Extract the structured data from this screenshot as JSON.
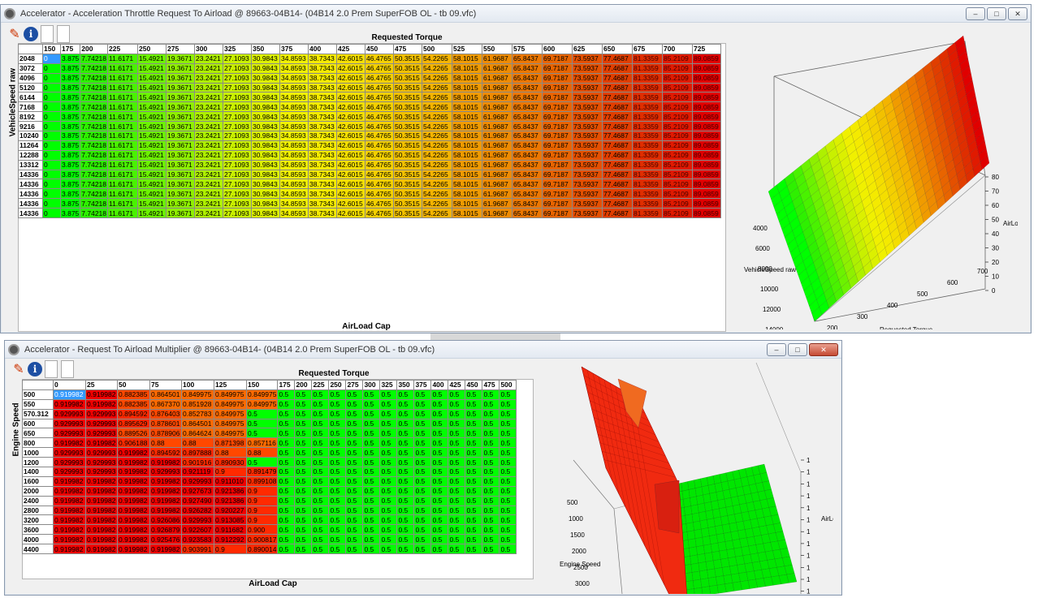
{
  "window1": {
    "title": "Accelerator - Acceleration Throttle Request To Airload @ 89663-04B14- (04B14 2.0 Prem SuperFOB OL - tb 09.vfc)",
    "minimize": "–",
    "maximize": "□",
    "close": "✕",
    "x_axis_title": "Requested Torque",
    "y_axis_title": "VehicleSpeed raw",
    "bottom_title": "AirLoad Cap",
    "cols": [
      "150",
      "175",
      "200",
      "225",
      "250",
      "275",
      "300",
      "325",
      "350",
      "375",
      "400",
      "425",
      "450",
      "475",
      "500",
      "525",
      "550",
      "575",
      "600",
      "625",
      "650",
      "675",
      "700",
      "725"
    ],
    "rows": [
      "2048",
      "3072",
      "4096",
      "5120",
      "6144",
      "7168",
      "8192",
      "9216",
      "10240",
      "11264",
      "12288",
      "13312",
      "14336",
      "14336",
      "14336",
      "14336",
      "14336"
    ],
    "row_values": [
      "0",
      "3.875",
      "7.74218",
      "11.6171",
      "15.4921",
      "19.3671",
      "23.2421",
      "27.1093",
      "30.9843",
      "34.8593",
      "38.7343",
      "42.6015",
      "46.4765",
      "50.3515",
      "54.2265",
      "58.1015",
      "61.9687",
      "65.8437",
      "69.7187",
      "73.5937",
      "77.4687",
      "81.3359",
      "85.2109",
      "89.0859"
    ],
    "colors": [
      "#00ff00",
      "#00ff00",
      "#2ef000",
      "#49f200",
      "#6cf200",
      "#8ef000",
      "#aef000",
      "#c9f000",
      "#dcf000",
      "#f0f000",
      "#f4ea00",
      "#f4de00",
      "#f4d000",
      "#f2c100",
      "#f4b400",
      "#f09b00",
      "#ee8b00",
      "#ec7700",
      "#e86400",
      "#e45000",
      "#e03e00",
      "#df2e00",
      "#e01a00",
      "#e00000"
    ],
    "plot": {
      "y_ticks": [
        "80",
        "70",
        "60",
        "50",
        "40",
        "30",
        "20",
        "10",
        "0"
      ],
      "vs_ticks": [
        "4000",
        "6000",
        "8000",
        "10000",
        "12000",
        "14000"
      ],
      "rt_ticks": [
        "200",
        "300",
        "400",
        "500",
        "600",
        "700"
      ],
      "axis_airload": "AirLoad",
      "axis_vs": "VehicleSpeed raw",
      "axis_rt": "Requested Torque"
    }
  },
  "window2": {
    "title": "Accelerator - Request To Airload Multiplier @ 89663-04B14- (04B14 2.0 Prem SuperFOB OL - tb 09.vfc)",
    "minimize": "–",
    "maximize": "□",
    "close": "✕",
    "x_axis_title": "Requested Torque",
    "y_axis_title": "Engine Speed",
    "bottom_title": "AirLoad Cap",
    "cols": [
      "0",
      "25",
      "50",
      "75",
      "100",
      "125",
      "150",
      "175",
      "200",
      "225",
      "250",
      "275",
      "300",
      "325",
      "350",
      "375",
      "400",
      "425",
      "450",
      "475",
      "500"
    ],
    "rows": [
      {
        "label": "500",
        "cells": [
          "0.919982",
          "0.919982",
          "0.882385",
          "0.864501",
          "0.849975",
          "0.849975",
          "0.849975",
          "0.5",
          "0.5",
          "0.5",
          "0.5",
          "0.5",
          "0.5",
          "0.5",
          "0.5",
          "0.5",
          "0.5",
          "0.5",
          "0.5",
          "0.5",
          "0.5"
        ]
      },
      {
        "label": "550",
        "cells": [
          "0.919982",
          "0.919982",
          "0.882385",
          "0.867370",
          "0.851928",
          "0.849975",
          "0.849975",
          "0.5",
          "0.5",
          "0.5",
          "0.5",
          "0.5",
          "0.5",
          "0.5",
          "0.5",
          "0.5",
          "0.5",
          "0.5",
          "0.5",
          "0.5",
          "0.5"
        ]
      },
      {
        "label": "570.312",
        "cells": [
          "0.929993",
          "0.929993",
          "0.894592",
          "0.876403",
          "0.852783",
          "0.849975",
          "0.5",
          "0.5",
          "0.5",
          "0.5",
          "0.5",
          "0.5",
          "0.5",
          "0.5",
          "0.5",
          "0.5",
          "0.5",
          "0.5",
          "0.5",
          "0.5",
          "0.5"
        ]
      },
      {
        "label": "600",
        "cells": [
          "0.929993",
          "0.929993",
          "0.895629",
          "0.878601",
          "0.864501",
          "0.849975",
          "0.5",
          "0.5",
          "0.5",
          "0.5",
          "0.5",
          "0.5",
          "0.5",
          "0.5",
          "0.5",
          "0.5",
          "0.5",
          "0.5",
          "0.5",
          "0.5",
          "0.5"
        ]
      },
      {
        "label": "650",
        "cells": [
          "0.929993",
          "0.929993",
          "0.889526",
          "0.878906",
          "0.864624",
          "0.849975",
          "0.5",
          "0.5",
          "0.5",
          "0.5",
          "0.5",
          "0.5",
          "0.5",
          "0.5",
          "0.5",
          "0.5",
          "0.5",
          "0.5",
          "0.5",
          "0.5",
          "0.5"
        ]
      },
      {
        "label": "800",
        "cells": [
          "0.919982",
          "0.919982",
          "0.906188",
          "0.88",
          "0.88",
          "0.871398",
          "0.857116",
          "0.5",
          "0.5",
          "0.5",
          "0.5",
          "0.5",
          "0.5",
          "0.5",
          "0.5",
          "0.5",
          "0.5",
          "0.5",
          "0.5",
          "0.5",
          "0.5"
        ]
      },
      {
        "label": "1000",
        "cells": [
          "0.929993",
          "0.929993",
          "0.919982",
          "0.894592",
          "0.897888",
          "0.88",
          "0.88",
          "0.5",
          "0.5",
          "0.5",
          "0.5",
          "0.5",
          "0.5",
          "0.5",
          "0.5",
          "0.5",
          "0.5",
          "0.5",
          "0.5",
          "0.5",
          "0.5"
        ]
      },
      {
        "label": "1200",
        "cells": [
          "0.929993",
          "0.929993",
          "0.919982",
          "0.919982",
          "0.901916",
          "0.890930",
          "0.5",
          "0.5",
          "0.5",
          "0.5",
          "0.5",
          "0.5",
          "0.5",
          "0.5",
          "0.5",
          "0.5",
          "0.5",
          "0.5",
          "0.5",
          "0.5",
          "0.5"
        ]
      },
      {
        "label": "1400",
        "cells": [
          "0.929993",
          "0.929993",
          "0.919982",
          "0.929993",
          "0.921119",
          "0.9",
          "0.891479",
          "0.5",
          "0.5",
          "0.5",
          "0.5",
          "0.5",
          "0.5",
          "0.5",
          "0.5",
          "0.5",
          "0.5",
          "0.5",
          "0.5",
          "0.5",
          "0.5"
        ]
      },
      {
        "label": "1600",
        "cells": [
          "0.919982",
          "0.919982",
          "0.919982",
          "0.919982",
          "0.929993",
          "0.911010",
          "0.899108",
          "0.5",
          "0.5",
          "0.5",
          "0.5",
          "0.5",
          "0.5",
          "0.5",
          "0.5",
          "0.5",
          "0.5",
          "0.5",
          "0.5",
          "0.5",
          "0.5"
        ]
      },
      {
        "label": "2000",
        "cells": [
          "0.919982",
          "0.919982",
          "0.919982",
          "0.919982",
          "0.927673",
          "0.921386",
          "0.9",
          "0.5",
          "0.5",
          "0.5",
          "0.5",
          "0.5",
          "0.5",
          "0.5",
          "0.5",
          "0.5",
          "0.5",
          "0.5",
          "0.5",
          "0.5",
          "0.5"
        ]
      },
      {
        "label": "2400",
        "cells": [
          "0.919982",
          "0.919982",
          "0.919982",
          "0.919982",
          "0.927490",
          "0.921386",
          "0.9",
          "0.5",
          "0.5",
          "0.5",
          "0.5",
          "0.5",
          "0.5",
          "0.5",
          "0.5",
          "0.5",
          "0.5",
          "0.5",
          "0.5",
          "0.5",
          "0.5"
        ]
      },
      {
        "label": "2800",
        "cells": [
          "0.919982",
          "0.919982",
          "0.919982",
          "0.919982",
          "0.926282",
          "0.920227",
          "0.9",
          "0.5",
          "0.5",
          "0.5",
          "0.5",
          "0.5",
          "0.5",
          "0.5",
          "0.5",
          "0.5",
          "0.5",
          "0.5",
          "0.5",
          "0.5",
          "0.5"
        ]
      },
      {
        "label": "3200",
        "cells": [
          "0.919982",
          "0.919982",
          "0.919982",
          "0.926086",
          "0.929993",
          "0.913085",
          "0.9",
          "0.5",
          "0.5",
          "0.5",
          "0.5",
          "0.5",
          "0.5",
          "0.5",
          "0.5",
          "0.5",
          "0.5",
          "0.5",
          "0.5",
          "0.5",
          "0.5"
        ]
      },
      {
        "label": "3600",
        "cells": [
          "0.919982",
          "0.919982",
          "0.919982",
          "0.926879",
          "0.922607",
          "0.911682",
          "0.900",
          "0.5",
          "0.5",
          "0.5",
          "0.5",
          "0.5",
          "0.5",
          "0.5",
          "0.5",
          "0.5",
          "0.5",
          "0.5",
          "0.5",
          "0.5",
          "0.5"
        ]
      },
      {
        "label": "4000",
        "cells": [
          "0.919982",
          "0.919982",
          "0.919982",
          "0.925476",
          "0.923583",
          "0.912292",
          "0.900817",
          "0.5",
          "0.5",
          "0.5",
          "0.5",
          "0.5",
          "0.5",
          "0.5",
          "0.5",
          "0.5",
          "0.5",
          "0.5",
          "0.5",
          "0.5",
          "0.5"
        ]
      },
      {
        "label": "4400",
        "cells": [
          "0.919982",
          "0.919982",
          "0.919982",
          "0.919982",
          "0.903991",
          "0.9",
          "0.890014",
          "0.5",
          "0.5",
          "0.5",
          "0.5",
          "0.5",
          "0.5",
          "0.5",
          "0.5",
          "0.5",
          "0.5",
          "0.5",
          "0.5",
          "0.5",
          "0.5"
        ]
      }
    ],
    "plot": {
      "y_ticks": [
        "1",
        "1",
        "1",
        "1",
        "1",
        "1",
        "1",
        "1",
        "1",
        "1",
        "1",
        "1"
      ],
      "es_ticks": [
        "500",
        "1000",
        "1500",
        "2000",
        "2500",
        "3000"
      ],
      "axis_airload": "AirLoa",
      "axis_es": "Engine Speed"
    }
  }
}
